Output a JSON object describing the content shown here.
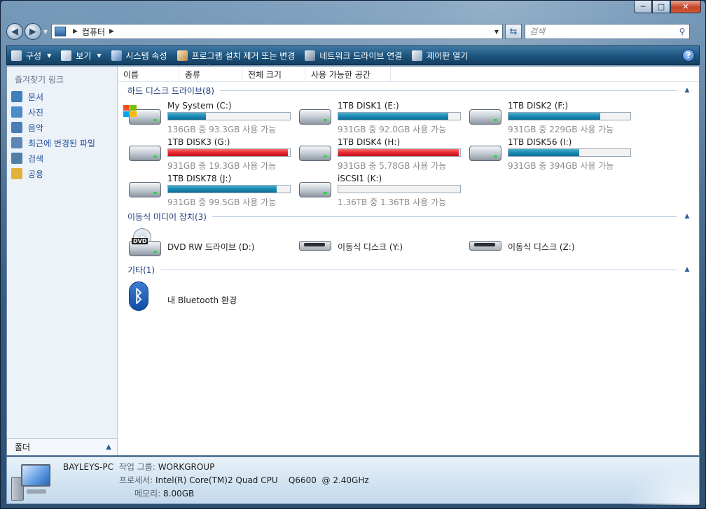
{
  "window": {
    "caption_buttons": {
      "minimize": "─",
      "maximize": "□",
      "close": "✕"
    }
  },
  "address_bar": {
    "crumb": "컴퓨터",
    "search_placeholder": "검색"
  },
  "toolbar": {
    "organize": "구성",
    "views": "보기",
    "system_properties": "시스템 속성",
    "uninstall": "프로그램 설치 제거 또는 변경",
    "map_drive": "네트워크 드라이브 연결",
    "control_panel": "제어판 열기",
    "help": "?"
  },
  "nav": {
    "title": "즐겨찾기 링크",
    "items": [
      {
        "label": "문서",
        "icon": "documents-icon",
        "color": "#3f7fb8"
      },
      {
        "label": "사진",
        "icon": "pictures-icon",
        "color": "#4d8cc7"
      },
      {
        "label": "음악",
        "icon": "music-icon",
        "color": "#4a7db5"
      },
      {
        "label": "최근에 변경된 파일",
        "icon": "recent-files-icon",
        "color": "#5d87b3"
      },
      {
        "label": "검색",
        "icon": "search-folder-icon",
        "color": "#4f7ea8"
      },
      {
        "label": "공용",
        "icon": "public-folder-icon",
        "color": "#e3b23c"
      }
    ],
    "folders_label": "폴더"
  },
  "columns": [
    "이름",
    "종류",
    "전체 크기",
    "사용 가능한 공간"
  ],
  "groups": {
    "hdd": {
      "title": "하드 디스크 드라이브(8)",
      "drives": [
        {
          "name": "My System (C:)",
          "free": "136GB 중 93.3GB 사용 가능",
          "used_fraction": 0.31,
          "warning": false,
          "windows": true
        },
        {
          "name": "1TB DISK1 (E:)",
          "free": "931GB 중 92.0GB 사용 가능",
          "used_fraction": 0.9,
          "warning": false
        },
        {
          "name": "1TB DISK2 (F:)",
          "free": "931GB 중 229GB 사용 가능",
          "used_fraction": 0.75,
          "warning": false
        },
        {
          "name": "1TB DISK3 (G:)",
          "free": "931GB 중 19.3GB 사용 가능",
          "used_fraction": 0.98,
          "warning": true
        },
        {
          "name": "1TB DISK4 (H:)",
          "free": "931GB 중 5.78GB 사용 가능",
          "used_fraction": 0.99,
          "warning": true
        },
        {
          "name": "1TB DISK56 (I:)",
          "free": "931GB 중 394GB 사용 가능",
          "used_fraction": 0.58,
          "warning": false
        },
        {
          "name": "1TB DISK78 (J:)",
          "free": "931GB 중 99.5GB 사용 가능",
          "used_fraction": 0.89,
          "warning": false
        },
        {
          "name": "iSCSI1 (K:)",
          "free": "1.36TB 중 1.36TB 사용 가능",
          "used_fraction": 0.0,
          "warning": false
        }
      ]
    },
    "removable": {
      "title": "이동식 미디어 장치(3)",
      "items": [
        {
          "name": "DVD RW 드라이브 (D:)",
          "type": "dvd",
          "badge": "DVD"
        },
        {
          "name": "이동식 디스크 (Y:)",
          "type": "removable"
        },
        {
          "name": "이동식 디스크 (Z:)",
          "type": "removable"
        }
      ]
    },
    "other": {
      "title": "기타(1)",
      "items": [
        {
          "name": "내 Bluetooth 환경",
          "type": "bluetooth"
        }
      ]
    }
  },
  "details": {
    "computer_name": "BAYLEYS-PC",
    "workgroup_label": "작업 그룹:",
    "workgroup": "WORKGROUP",
    "processor_label": "프로세서:",
    "processor": "Intel(R) Core(TM)2 Quad CPU    Q6600  @ 2.40GHz",
    "memory_label": "메모리:",
    "memory": "8.00GB"
  },
  "colors": {
    "bar_normal": "#1b89b2",
    "bar_warning": "#e0232e",
    "link": "#1e4f96",
    "group_title": "#1e3d7b"
  }
}
